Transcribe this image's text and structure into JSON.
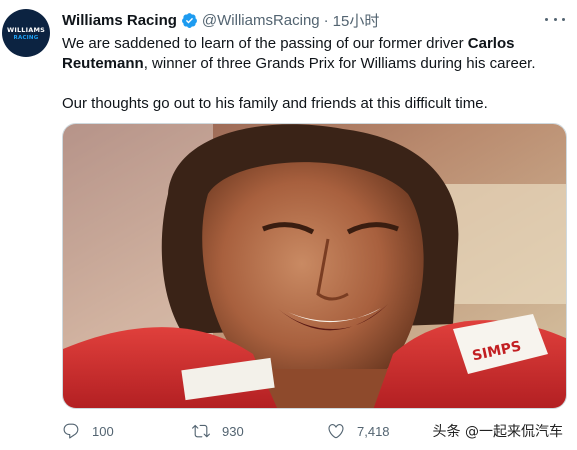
{
  "tweet": {
    "author_name": "Williams Racing",
    "author_handle": "@WilliamsRacing",
    "separator": "·",
    "timestamp": "15小时",
    "avatar": {
      "line1": "WILLIAMS",
      "line2": "RACING",
      "bg_color": "#0c2341"
    },
    "body": {
      "p1_prefix": "We are saddened to learn of the passing of our former driver ",
      "p1_bold": "Carlos Reutemann",
      "p1_suffix": ", winner of three Grands Prix for Williams during his career.",
      "p2": "Our thoughts go out to his family and friends at this difficult time."
    },
    "media": {
      "description_icon": "photo",
      "suit_patch_text": "SIMPS"
    },
    "actions": {
      "reply_count": "100",
      "retweet_count": "930",
      "like_count": "7,418"
    }
  },
  "watermark": "头条 @一起来侃汽车",
  "colors": {
    "verified": "#1d9bf0",
    "muted": "#536471",
    "text": "#0f1419"
  }
}
